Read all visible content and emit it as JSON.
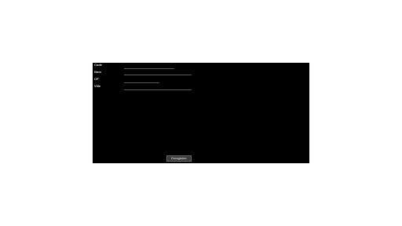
{
  "form": {
    "fields": [
      {
        "label": "Code",
        "value": "",
        "placeholder": ""
      },
      {
        "label": "Nom",
        "value": "",
        "placeholder": ""
      },
      {
        "label": "CP",
        "value": "",
        "placeholder": ""
      },
      {
        "label": "Ville",
        "value": "",
        "placeholder": ""
      }
    ],
    "save_label": "Enregistrer"
  },
  "colors": {
    "panel_bg": "#000000",
    "page_bg": "#ffffff",
    "button_bg": "#3a3a3a",
    "field_underline": "#5a5a5a"
  }
}
